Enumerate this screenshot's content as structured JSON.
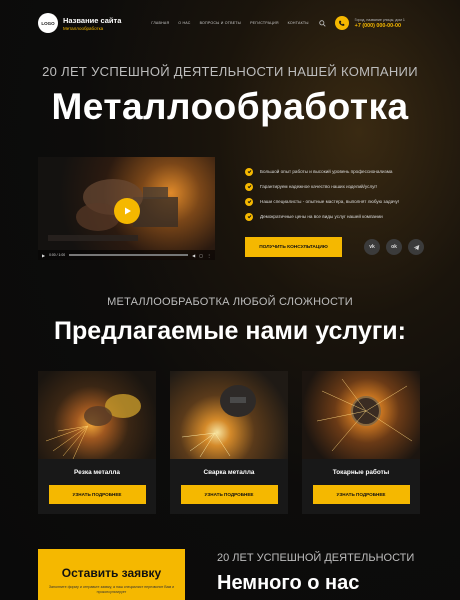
{
  "header": {
    "logo": "LOGO",
    "site_name": "Название сайта",
    "site_sub": "Металлообработка",
    "nav": [
      "ГЛАВНАЯ",
      "О НАС",
      "ВОПРОСЫ И ОТВЕТЫ",
      "РЕГИСТРАЦИЯ",
      "КОНТАКТЫ"
    ],
    "address": "Город, название улицы, дом 1",
    "phone": "+7 (000) 000-00-00"
  },
  "hero": {
    "subtitle": "20 ЛЕТ УСПЕШНОЙ ДЕЯТЕЛЬНОСТИ НАШЕЙ КОМПАНИИ",
    "title": "Металлообработка"
  },
  "video": {
    "time": "0:00 / 1:00"
  },
  "benefits": [
    "Большой опыт работы и высокий уровень профессионализма",
    "Гарантируем надежное качество наших изделий/услуг!",
    "Наши специалисты - опытные мастера, выполнят любую задачу!",
    "Демократичные цены на все виды услуг нашей компании"
  ],
  "consult_button": "ПОЛУЧИТЬ КОНСУЛЬТАЦИЮ",
  "socials": [
    "vk",
    "ok",
    "tg"
  ],
  "services": {
    "subtitle": "МЕТАЛЛООБРАБОТКА ЛЮБОЙ СЛОЖНОСТИ",
    "title": "Предлагаемые нами услуги:",
    "items": [
      {
        "title": "Резка металла",
        "button": "УЗНАТЬ ПОДРОБНЕЕ"
      },
      {
        "title": "Сварка металла",
        "button": "УЗНАТЬ ПОДРОБНЕЕ"
      },
      {
        "title": "Токарные работы",
        "button": "УЗНАТЬ ПОДРОБНЕЕ"
      }
    ]
  },
  "request": {
    "title": "Оставить заявку",
    "text": "Заполните форму и отправьте заявку, а наш специалист перезвонит Вам и проконсультирует"
  },
  "about": {
    "subtitle": "20 ЛЕТ УСПЕШНОЙ ДЕЯТЕЛЬНОСТИ",
    "title": "Немного о нас"
  },
  "colors": {
    "accent": "#f5b800",
    "background": "#0b0b0b",
    "card": "#181818"
  }
}
